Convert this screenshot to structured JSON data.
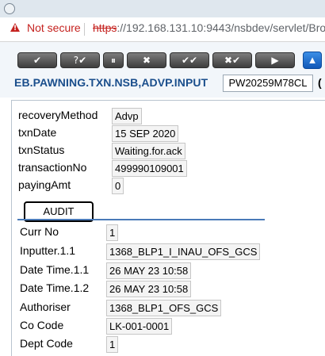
{
  "browser": {
    "security_label": "Not secure",
    "url_scheme": "https",
    "url_rest": "://192.168.131.10:9443/nsbdev/servlet/Bro"
  },
  "toolbar": {
    "buttons": [
      {
        "label": "✔"
      },
      {
        "label": "?✔"
      },
      {
        "label": "⏸"
      },
      {
        "label": "✖"
      },
      {
        "label": "✔✔"
      },
      {
        "label": "✖✔"
      },
      {
        "label": "▶"
      },
      {
        "label": "▲"
      }
    ]
  },
  "header": {
    "title": "EB.PAWNING.TXN.NSB,ADVP.INPUT",
    "txn_id": "PW20259M78CL",
    "trailing": "("
  },
  "main_fields": [
    {
      "label": "recoveryMethod",
      "value": "Advp"
    },
    {
      "label": "txnDate",
      "value": "15 SEP 2020"
    },
    {
      "label": "txnStatus",
      "value": "Waiting.for.ack"
    },
    {
      "label": "transactionNo",
      "value": "499990109001"
    },
    {
      "label": "payingAmt",
      "value": "0"
    }
  ],
  "audit_tab": {
    "label": "AUDIT"
  },
  "audit_fields": [
    {
      "label": "Curr No",
      "value": "1"
    },
    {
      "label": "Inputter.1.1",
      "value": "1368_BLP1_I_INAU_OFS_GCS"
    },
    {
      "label": "Date Time.1.1",
      "value": "26 MAY 23 10:58"
    },
    {
      "label": "Date Time.1.2",
      "value": "26 MAY 23 10:58"
    },
    {
      "label": "Authoriser",
      "value": "1368_BLP1_OFS_GCS"
    },
    {
      "label": "Co Code",
      "value": "LK-001-0001"
    },
    {
      "label": "Dept Code",
      "value": "1"
    }
  ]
}
